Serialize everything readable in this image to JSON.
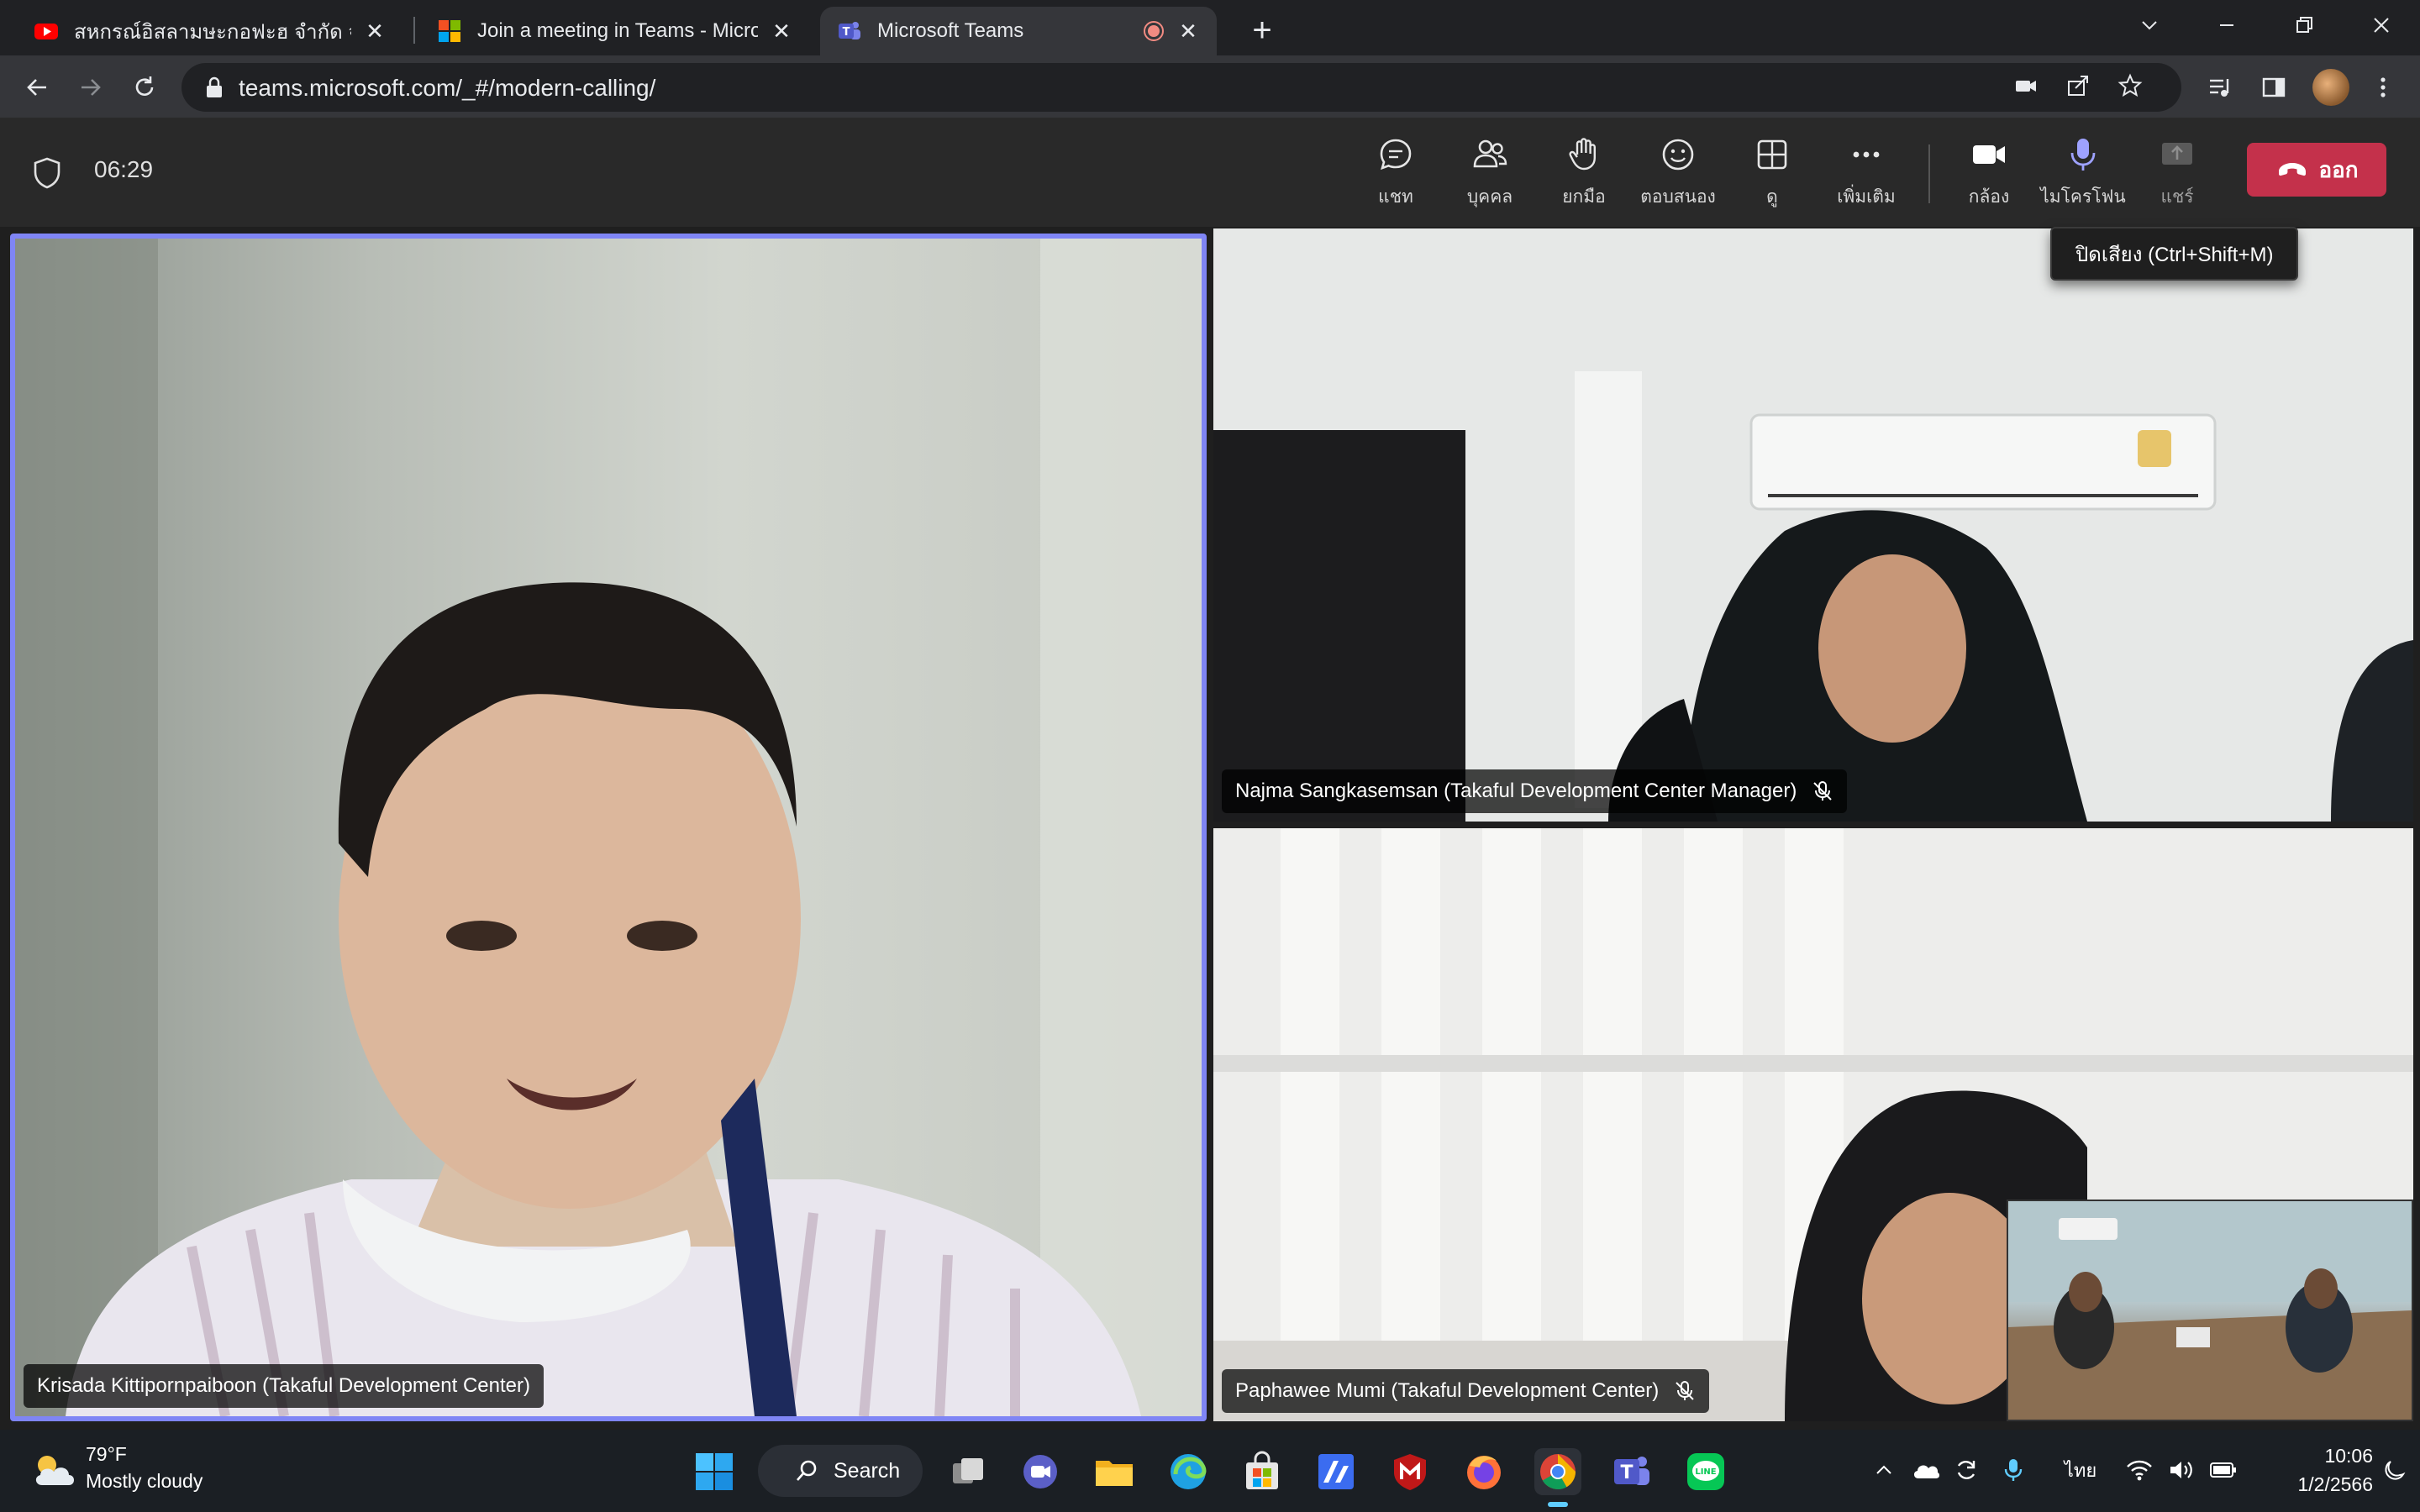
{
  "browser": {
    "tabs": [
      {
        "title": "สหกรณ์อิสลามษะกอฟะฮ จำกัด จากอดี"
      },
      {
        "title": "Join a meeting in Teams - Micros"
      },
      {
        "title": "Microsoft Teams"
      }
    ],
    "new_tab": "+",
    "url": "teams.microsoft.com/_#/modern-calling/"
  },
  "meeting": {
    "timer": "06:29",
    "controls": {
      "chat": "แชท",
      "people": "บุคคล",
      "raise_hand": "ยกมือ",
      "react": "ตอบสนอง",
      "view": "ดู",
      "more": "เพิ่มเติม",
      "camera": "กล้อง",
      "mic": "ไมโครโฟน",
      "share": "แชร์",
      "leave": "ออก"
    },
    "tooltip": "ปิดเสียง (Ctrl+Shift+M)",
    "participants": [
      {
        "name": "Krisada Kittipornpaiboon (Takaful Development Center)"
      },
      {
        "name": "Najma Sangkasemsan (Takaful Development Center Manager)"
      },
      {
        "name": "Paphawee Mumi (Takaful Development Center)"
      }
    ]
  },
  "taskbar": {
    "weather_temp": "79°F",
    "weather_desc": "Mostly cloudy",
    "search": "Search",
    "lang": "ไทย",
    "time": "10:06",
    "date": "1/2/2566"
  },
  "colors": {
    "accent": "#7f85f5",
    "leave": "#c4314b",
    "mic_active": "#9ea2ff"
  }
}
